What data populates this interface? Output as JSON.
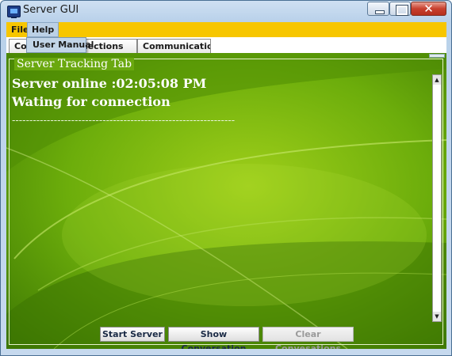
{
  "window": {
    "title": "Server GUI"
  },
  "menu": {
    "file": "File",
    "help": "Help",
    "help_items": [
      "User Manual"
    ]
  },
  "tabs": [
    {
      "label": "Control",
      "shown": "Con"
    },
    {
      "label": "Connections",
      "shown": "nnections"
    },
    {
      "label": "Communications",
      "shown": "Communications"
    }
  ],
  "panel": {
    "legend": "Server Tracking Tab",
    "log": [
      "Server online :02:05:08 PM",
      "Wating for connection",
      "----------------------------------------------------------------"
    ]
  },
  "buttons": {
    "start": "Start Server",
    "show": "Show Conversation",
    "clear": "Clear Convesations",
    "clear_enabled": false
  },
  "colors": {
    "menubar": "#f7c600",
    "background": "#5d9e06"
  }
}
